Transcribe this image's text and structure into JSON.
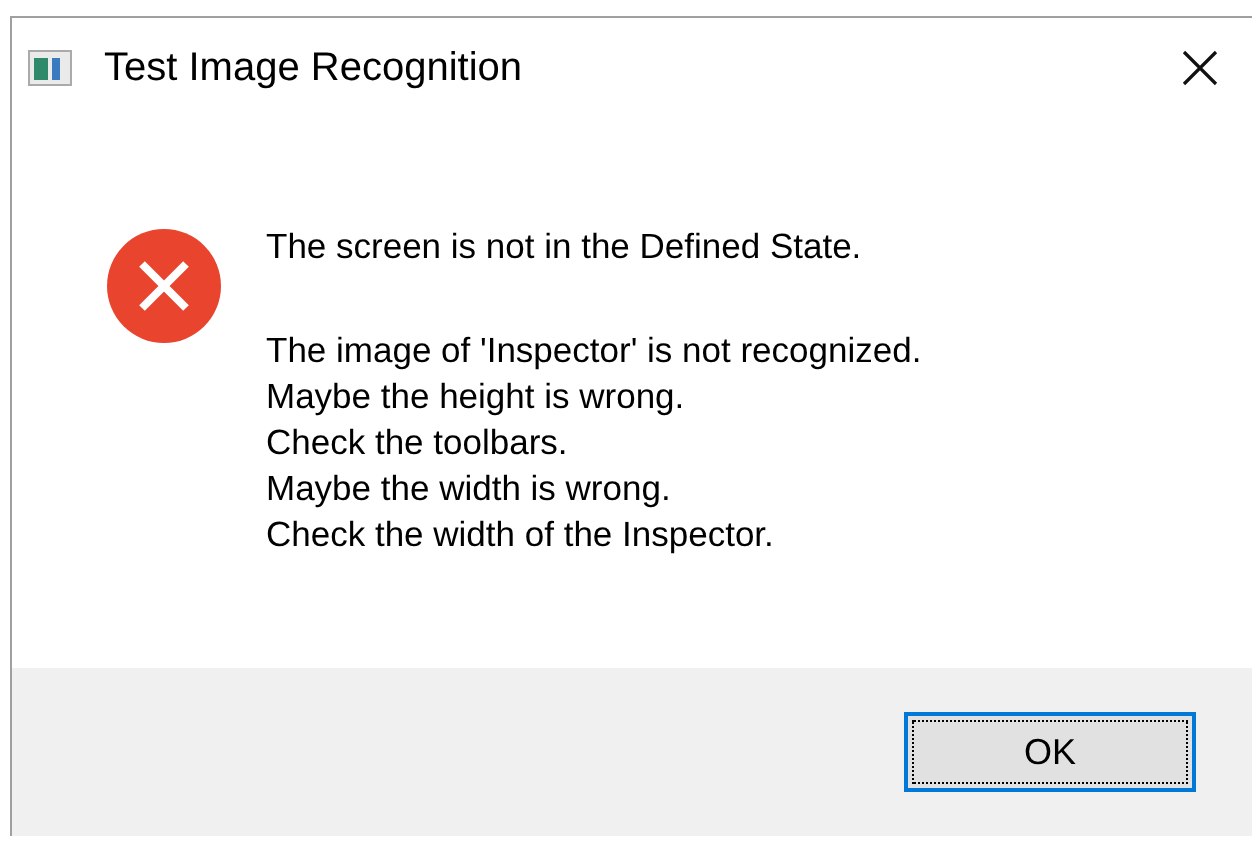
{
  "window": {
    "title": "Test Image Recognition"
  },
  "message": {
    "heading": "The screen is not in the Defined State.",
    "lines": [
      "The image of 'Inspector' is not recognized.",
      "Maybe the height is wrong.",
      "Check the toolbars.",
      "Maybe the width is wrong.",
      "Check the width of the Inspector."
    ]
  },
  "buttons": [
    {
      "label": "OK",
      "focused": true
    }
  ]
}
